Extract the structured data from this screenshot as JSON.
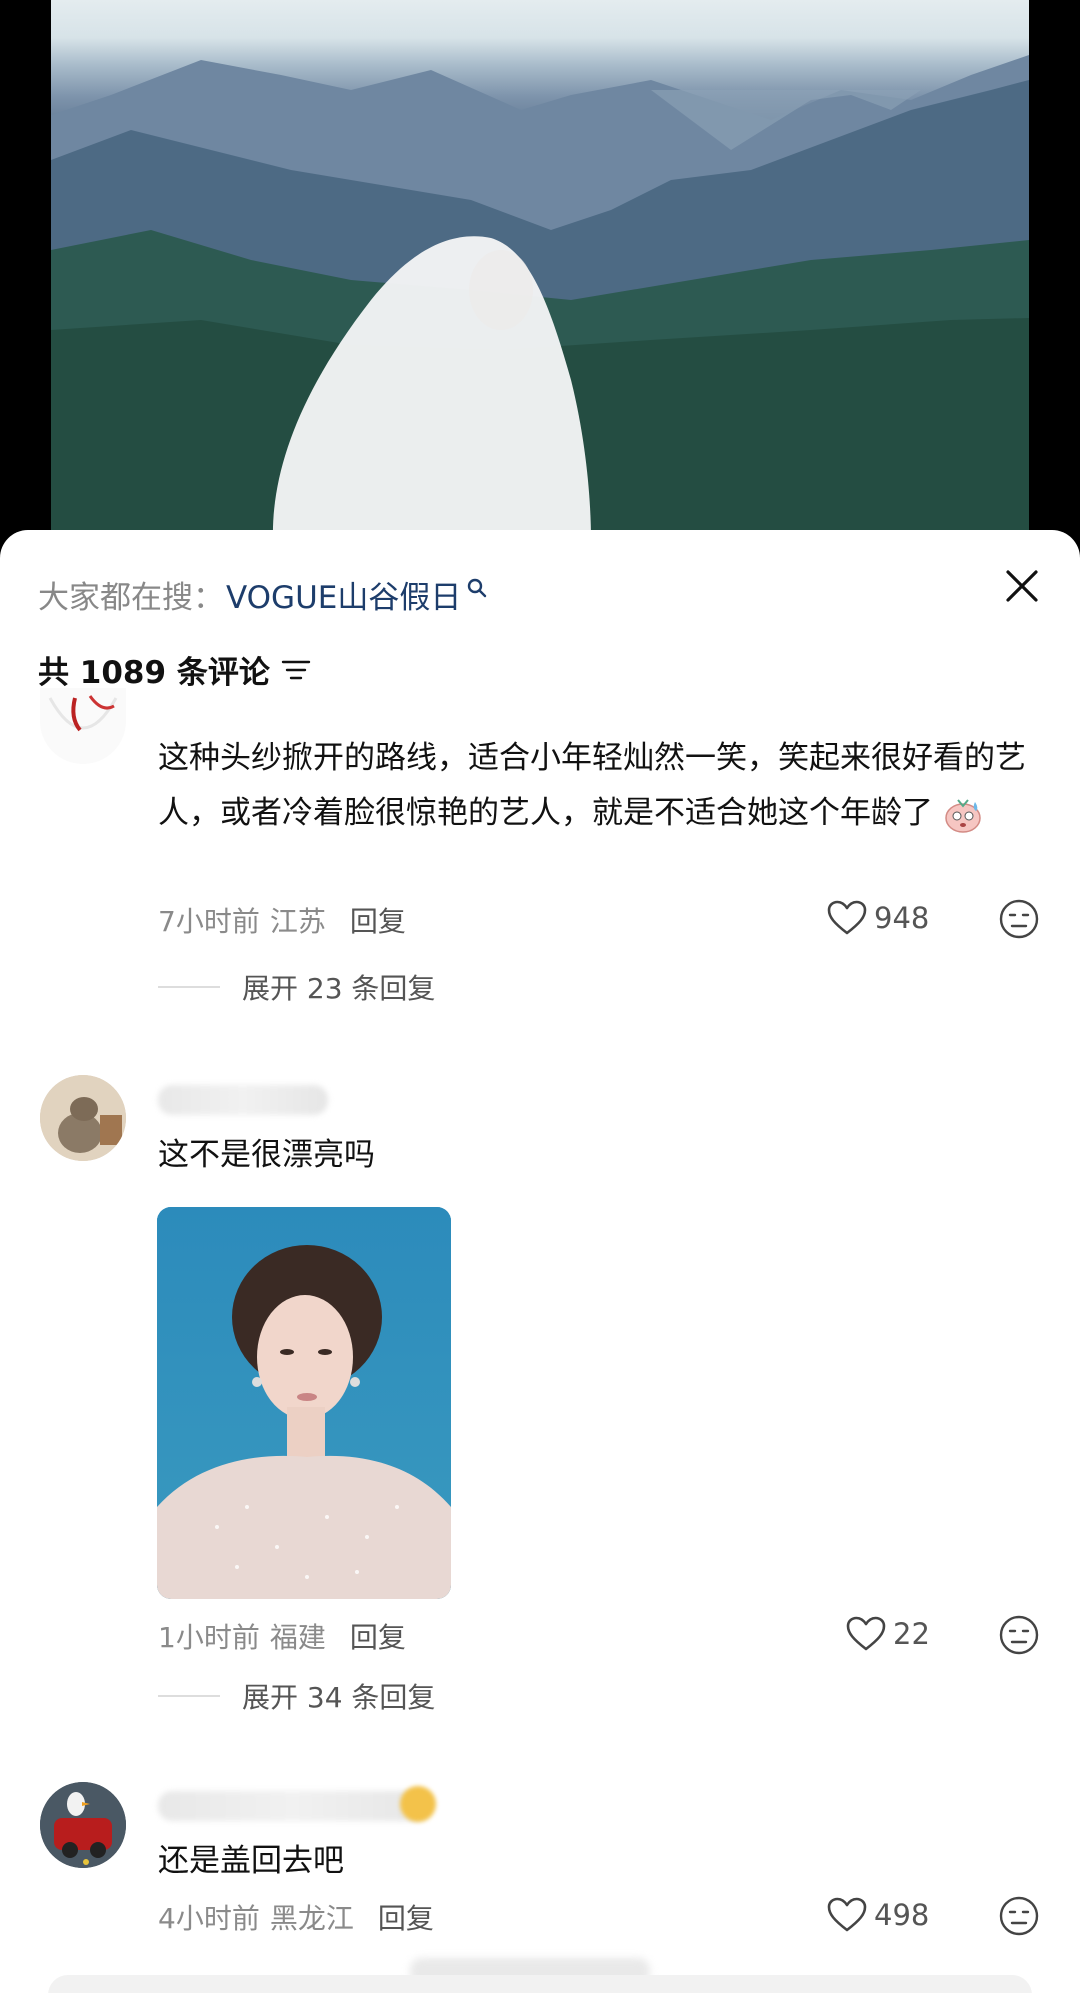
{
  "search_hint": {
    "label": "大家都在搜：",
    "query": "VOGUE山谷假日"
  },
  "comments_header": {
    "count_text": "共 1089 条评论"
  },
  "comments": [
    {
      "text": "这种头纱掀开的路线，适合小年轻灿然一笑，笑起来很好看的艺人，或者冷着脸很惊艳的艺人，就是不适合她这个年龄了",
      "time": "7小时前",
      "location": "江苏",
      "reply_label": "回复",
      "likes": "948",
      "expand_label": "展开 23 条回复"
    },
    {
      "text": "这不是很漂亮吗",
      "time": "1小时前",
      "location": "福建",
      "reply_label": "回复",
      "likes": "22",
      "expand_label": "展开 34 条回复"
    },
    {
      "text": "还是盖回去吧",
      "time": "4小时前",
      "location": "黑龙江",
      "reply_label": "回复",
      "likes": "498"
    }
  ],
  "icons": {
    "close": "close-icon",
    "search": "search-icon",
    "filter": "filter-icon",
    "like": "heart-icon",
    "emoji": "emoji-face-icon"
  },
  "colors": {
    "search_query": "#1d3d6b",
    "meta_text": "#8a8a8a",
    "sheet_background": "#ffffff"
  }
}
